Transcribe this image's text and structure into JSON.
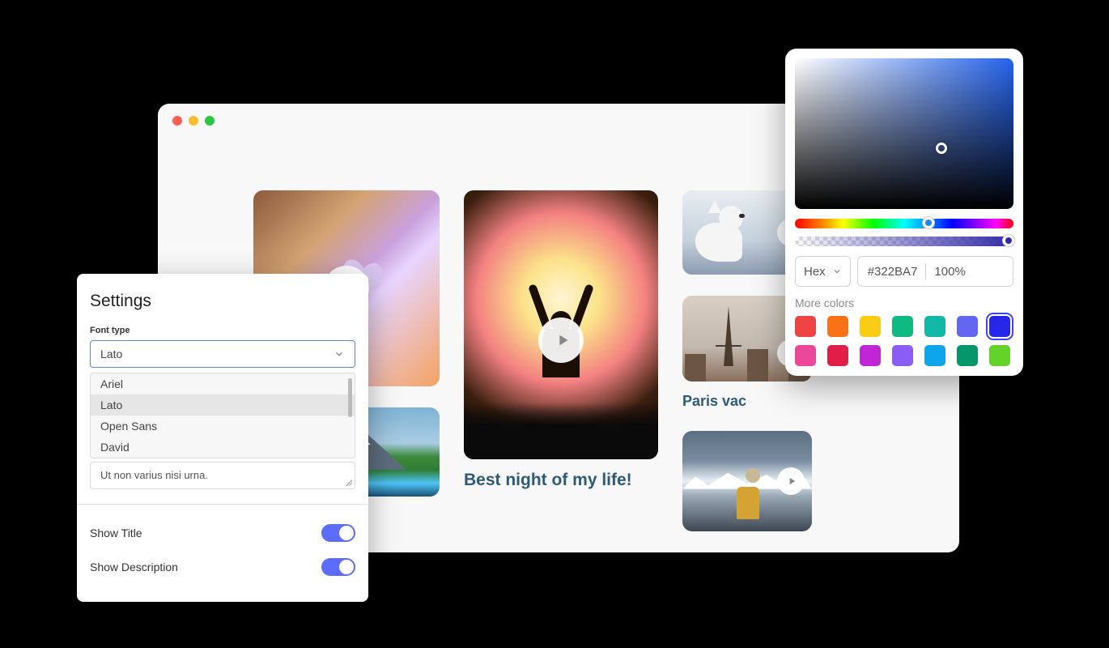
{
  "browser": {
    "gallery": {
      "cards": [
        {
          "kind": "flower",
          "title": ""
        },
        {
          "kind": "mountain",
          "title": ""
        },
        {
          "kind": "concert",
          "title": "Best night of my life!"
        },
        {
          "kind": "dog",
          "title": ""
        },
        {
          "kind": "paris",
          "title": "Paris vac"
        },
        {
          "kind": "alps",
          "title": ""
        }
      ]
    }
  },
  "settings": {
    "title": "Settings",
    "font_type_label": "Font type",
    "font_selected": "Lato",
    "font_options": [
      "Ariel",
      "Lato",
      "Open Sans",
      "David"
    ],
    "placeholder_text": "Ut non varius nisi urna.",
    "show_title_label": "Show Title",
    "show_title_on": true,
    "show_description_label": "Show Description",
    "show_description_on": true
  },
  "color_picker": {
    "format_label": "Hex",
    "hex_value": "#322BA7",
    "opacity_label": "100%",
    "more_colors_label": "More colors",
    "swatches": [
      {
        "color": "#ef4444",
        "selected": false
      },
      {
        "color": "#f97316",
        "selected": false
      },
      {
        "color": "#facc15",
        "selected": false
      },
      {
        "color": "#10b981",
        "selected": false
      },
      {
        "color": "#14b8a6",
        "selected": false
      },
      {
        "color": "#6366f1",
        "selected": false
      },
      {
        "color": "#2626e6",
        "selected": true
      },
      {
        "color": "#ec4899",
        "selected": false
      },
      {
        "color": "#e11d48",
        "selected": false
      },
      {
        "color": "#c026d3",
        "selected": false
      },
      {
        "color": "#8b5cf6",
        "selected": false
      },
      {
        "color": "#0ea5e9",
        "selected": false
      },
      {
        "color": "#059669",
        "selected": false
      },
      {
        "color": "#65d12b",
        "selected": false
      }
    ]
  }
}
